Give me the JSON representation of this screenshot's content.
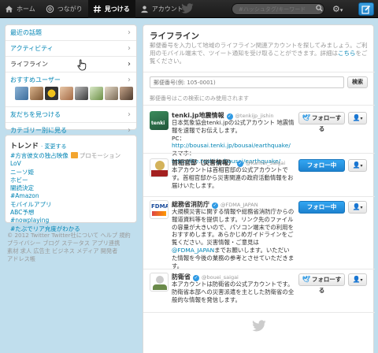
{
  "nav": {
    "home": "ホーム",
    "connect": "つながり",
    "discover": "見つける",
    "account": "アカウント"
  },
  "search": {
    "placeholder": "#ハッシュタグ/キーワード"
  },
  "sidebar": {
    "items": [
      {
        "label": "最近の話題"
      },
      {
        "label": "アクティビティ"
      },
      {
        "label": "ライフライン"
      },
      {
        "label": "おすすめユーザー"
      },
      {
        "label": "友だちを見つける"
      },
      {
        "label": "カテゴリー別に見る"
      }
    ]
  },
  "trends": {
    "title": "トレンド",
    "change": "· 変更する",
    "promoted_label": "プロモーション",
    "items": [
      "#方言彼女の独占映像",
      "LoV",
      "ニーソ姫",
      "ホビー",
      "闇読決定",
      "#Amazon",
      "モバイルアプリ",
      "ABC予想",
      "#nowplaying",
      "#たぶでリア充度がわかる"
    ]
  },
  "footer": {
    "line1": "© 2012 Twitter Twitter社について ヘルプ 規約",
    "line2": "プライバシー ブログ ステータス アプリ連携",
    "line3": "素材 求人 広告主 ビジネス メディア 開発者",
    "line4": "アドレス帳"
  },
  "main": {
    "title": "ライフライン",
    "desc_before": "郵便番号を入力して地域のライフライン関連アカウントを探してみましょう。ご利用のモバイル端末で、ツイート通知を受け取ることができます。詳細は",
    "desc_link": "こちら",
    "desc_after": "をご覧ください。",
    "zip_placeholder": "郵便番号(例: 105-0001)",
    "search_button": "検索",
    "zip_note": "郵便番号はこの検索にのみ使用されます"
  },
  "accounts": [
    {
      "name": "tenki.jp地震情報",
      "handle": "@tenkijp_jishin",
      "bio": "日本気象協会tenki.jpの公式アカウント 地震情報を速報でお伝えします。",
      "bio_link_label": "PC：",
      "bio_link": "http://bousai.tenki.jp/bousai/earthquake/",
      "bio_link2_label": " スマホ：",
      "bio_link2": "http://lite.tenki.jp/bousai/earthquake/",
      "button": "フォローする",
      "following": false
    },
    {
      "name": "首相官邸（災害情報）",
      "handle": "@Kantei_Saigai",
      "bio": "本アカウントは首相官邸の公式アカウントです。首相官邸から災害関連の政府活動情報をお届けいたします。",
      "button": "フォロー中",
      "following": true
    },
    {
      "name": "総務省消防庁",
      "handle": "@FDMA_JAPAN",
      "bio": "大規模災害に関する情報や総務省消防庁からの報道資料等を提供します。リンク先のファイルの容量が大きいので、パソコン端末での利用をおすすめします。あらかじめガイドラインをご覧ください。災害情報・ご意見は",
      "bio_link": "@FDMA_JAPAN",
      "bio_after": "までお願いします。いただいた情報を今後の業務の参考とさせていただきます。",
      "button": "フォロー中",
      "following": true
    },
    {
      "name": "防衛省",
      "handle": "@bouei_saigai",
      "bio": "本アカウントは防衛省の公式アカウントです。防衛省本部への災害派遣を主とした防衛省の全般的な情報を発信します。",
      "button": "フォローする",
      "following": false
    }
  ],
  "colors": {
    "link": "#0084b4",
    "follow_blue": "#2f9ae4",
    "background": "#c0deed",
    "topbar": "#222222"
  },
  "icons": {
    "home": "house-icon",
    "connect": "at-icon",
    "discover": "hash-icon",
    "account": "person-icon",
    "settings": "gear-icon",
    "compose": "compose-icon"
  }
}
